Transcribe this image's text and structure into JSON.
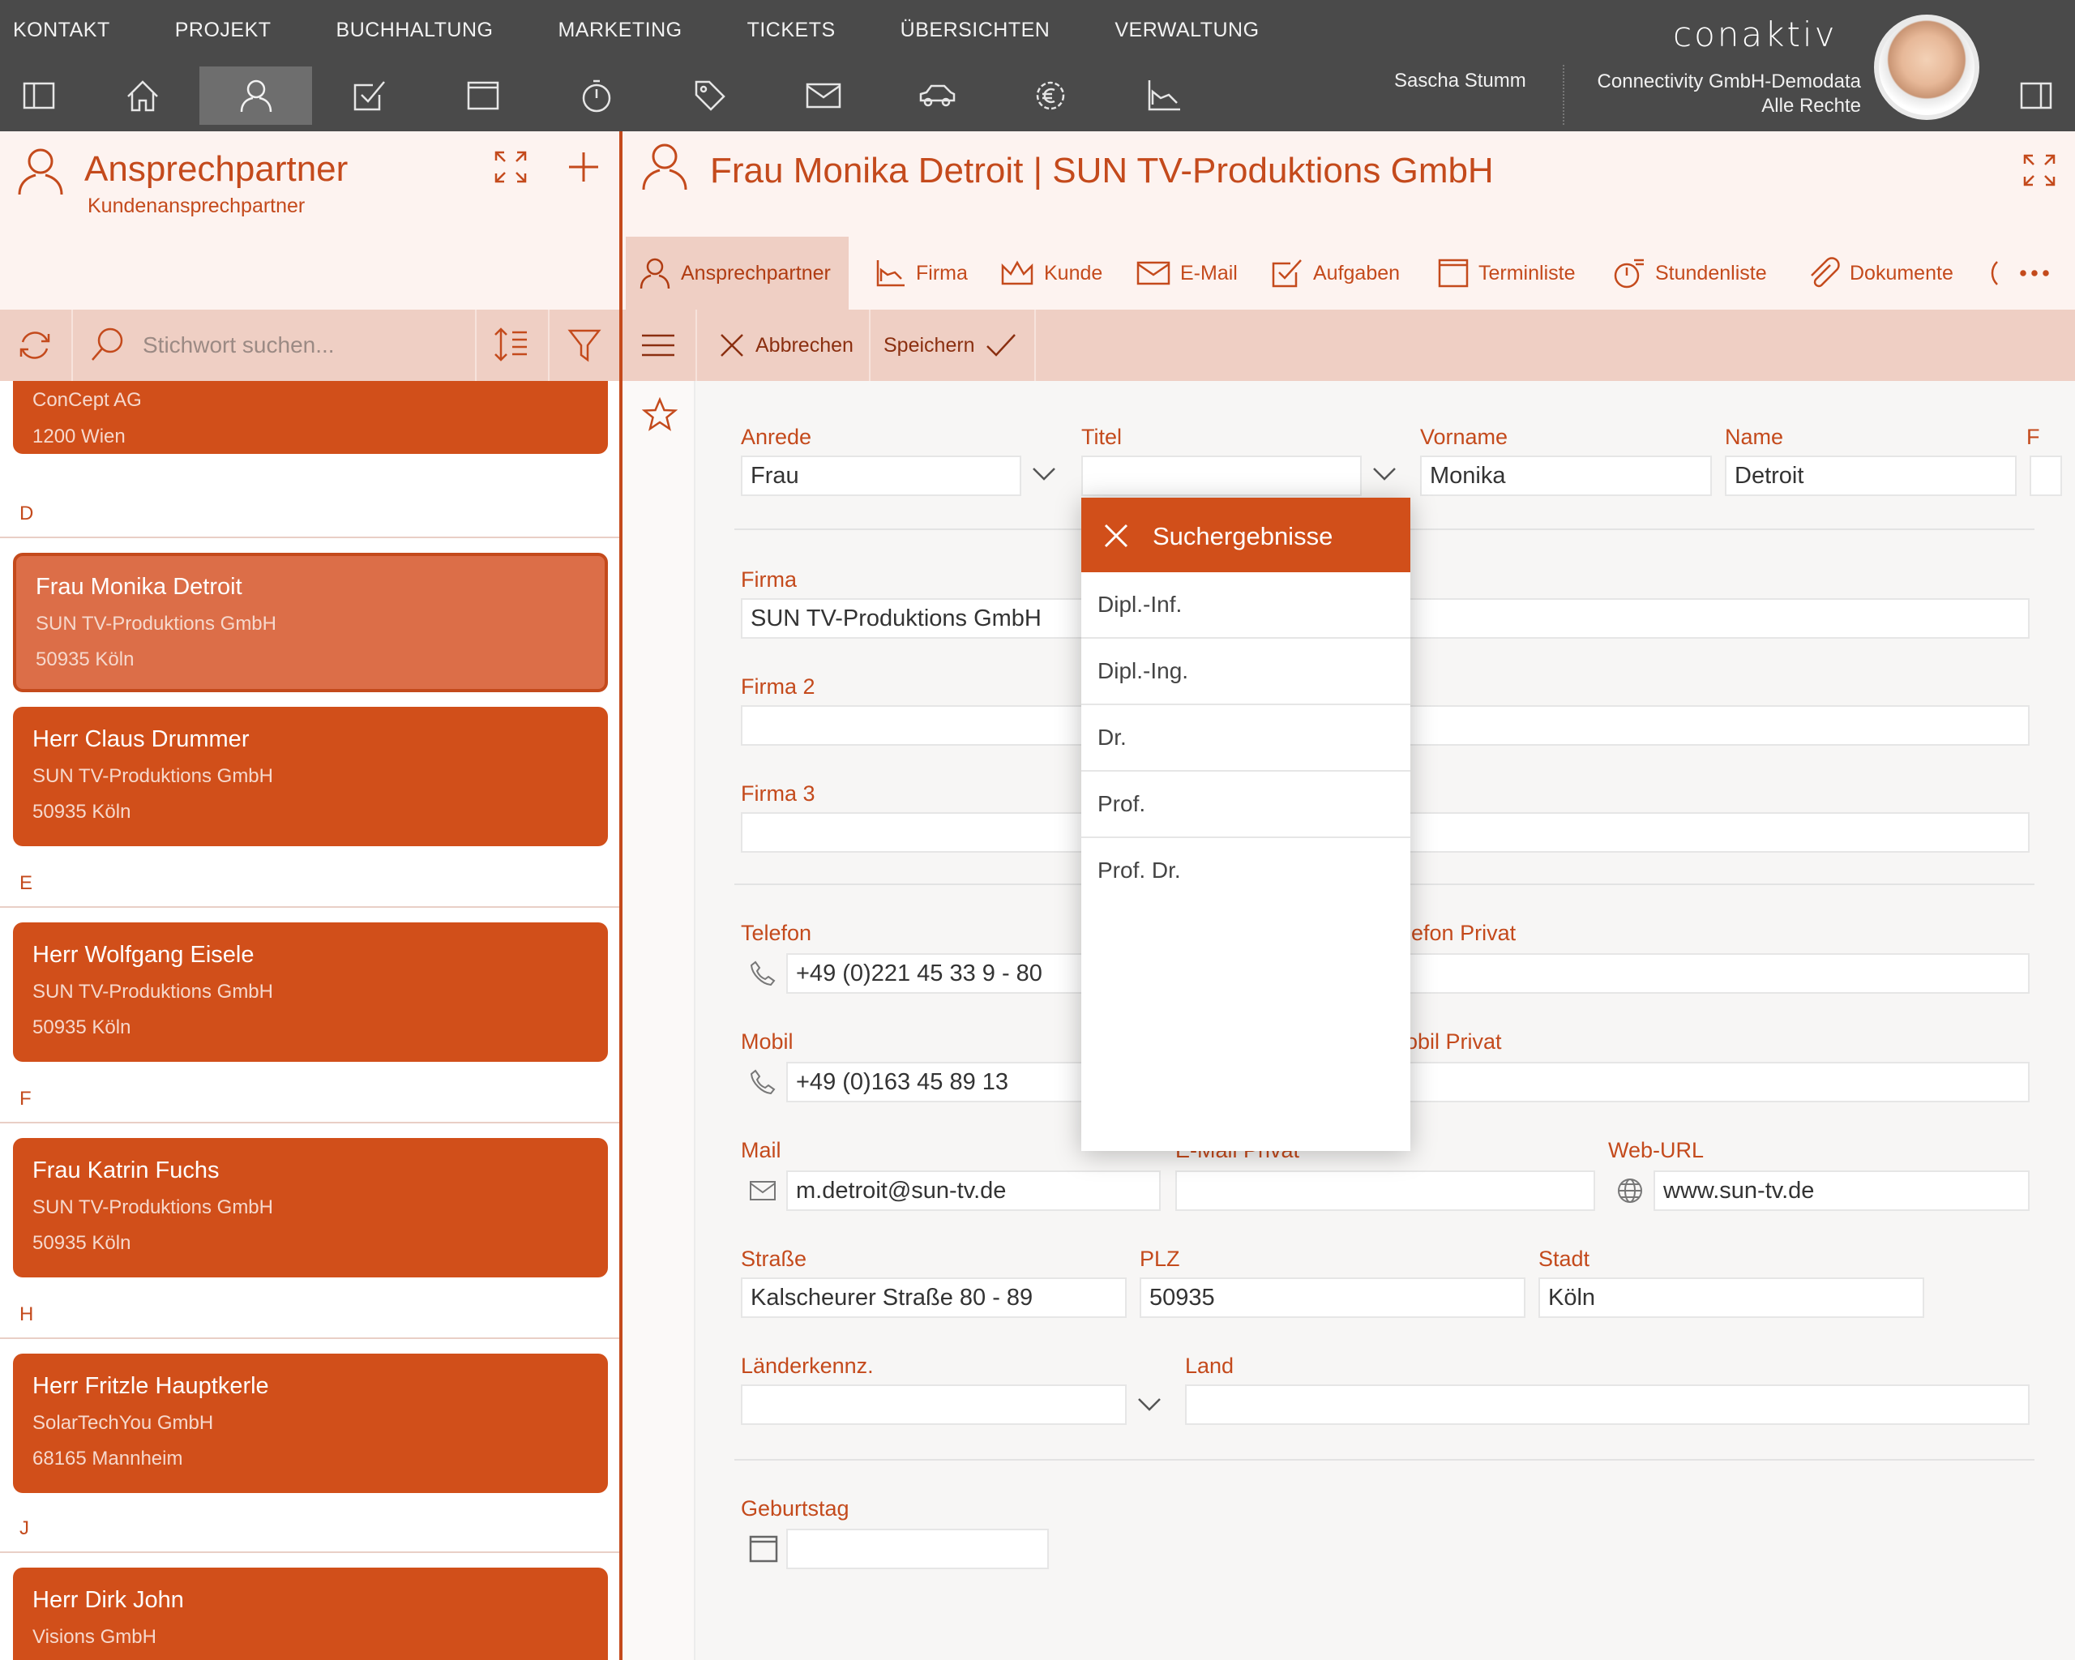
{
  "top_menu": [
    "KONTAKT",
    "PROJEKT",
    "BUCHHALTUNG",
    "MARKETING",
    "TICKETS",
    "ÜBERSICHTEN",
    "VERWALTUNG"
  ],
  "logo": "conaktiv",
  "user": {
    "name": "Sascha Stumm",
    "org": "Connectivity GmbH-Demodata",
    "rights": "Alle Rechte"
  },
  "left_panel": {
    "title": "Ansprechpartner",
    "subtitle": "Kundenansprechpartner",
    "search_placeholder": "Stichwort suchen...",
    "contacts": [
      {
        "company": "ConCept AG",
        "city": "1200 Wien"
      },
      {
        "letter": "D"
      },
      {
        "name": "Frau Monika Detroit",
        "company": "SUN TV-Produktions GmbH",
        "city": "50935 Köln",
        "selected": true
      },
      {
        "name": "Herr Claus Drummer",
        "company": "SUN TV-Produktions GmbH",
        "city": "50935 Köln"
      },
      {
        "letter": "E"
      },
      {
        "name": "Herr Wolfgang Eisele",
        "company": "SUN TV-Produktions GmbH",
        "city": "50935 Köln"
      },
      {
        "letter": "F"
      },
      {
        "name": "Frau Katrin Fuchs",
        "company": "SUN TV-Produktions GmbH",
        "city": "50935 Köln"
      },
      {
        "letter": "H"
      },
      {
        "name": "Herr Fritzle Hauptkerle",
        "company": "SolarTechYou GmbH",
        "city": "68165 Mannheim"
      },
      {
        "letter": "J"
      },
      {
        "name": "Herr Dirk John",
        "company": "Visions GmbH"
      }
    ]
  },
  "detail": {
    "title": "Frau Monika Detroit | SUN TV-Produktions GmbH",
    "tabs": [
      "Ansprechpartner",
      "Firma",
      "Kunde",
      "E-Mail",
      "Aufgaben",
      "Terminliste",
      "Stundenliste",
      "Dokumente"
    ],
    "actions": {
      "cancel": "Abbrechen",
      "save": "Speichern"
    },
    "form": {
      "anrede": {
        "label": "Anrede",
        "value": "Frau"
      },
      "titel": {
        "label": "Titel",
        "value": ""
      },
      "vorname": {
        "label": "Vorname",
        "value": "Monika"
      },
      "name": {
        "label": "Name",
        "value": "Detroit"
      },
      "cut_label": "F",
      "firma": {
        "label": "Firma",
        "value": "SUN TV-Produktions GmbH"
      },
      "firma2": {
        "label": "Firma 2",
        "value": ""
      },
      "firma3": {
        "label": "Firma 3",
        "value": ""
      },
      "telefon": {
        "label": "Telefon",
        "value": "+49 (0)221 45 33 9 - 80"
      },
      "telefon_privat": {
        "label": "elefon Privat",
        "value": ""
      },
      "mobil": {
        "label": "Mobil",
        "value": "+49 (0)163 45 89 13"
      },
      "mobil_privat": {
        "label": "obil Privat",
        "value": ""
      },
      "mail": {
        "label": "Mail",
        "value": "m.detroit@sun-tv.de"
      },
      "email_privat": {
        "label": "E-Mail Privat",
        "value": ""
      },
      "web": {
        "label": "Web-URL",
        "value": "www.sun-tv.de"
      },
      "strasse": {
        "label": "Straße",
        "value": "Kalscheurer Straße 80 - 89"
      },
      "plz": {
        "label": "PLZ",
        "value": "50935"
      },
      "stadt": {
        "label": "Stadt",
        "value": "Köln"
      },
      "laenderkennz": {
        "label": "Länderkennz.",
        "value": ""
      },
      "land": {
        "label": "Land",
        "value": ""
      },
      "geburtstag": {
        "label": "Geburtstag",
        "value": ""
      }
    }
  },
  "dropdown": {
    "title": "Suchergebnisse",
    "options": [
      "Dipl.-Inf.",
      "Dipl.-Ing.",
      "Dr.",
      "Prof.",
      "Prof. Dr."
    ]
  },
  "colors": {
    "accent": "#d14f1a",
    "accent_dark": "#c44a1c",
    "topbar": "#4a4a4a",
    "header_bg": "#fdf3f0",
    "toolbar_bg": "#efcfc4"
  }
}
